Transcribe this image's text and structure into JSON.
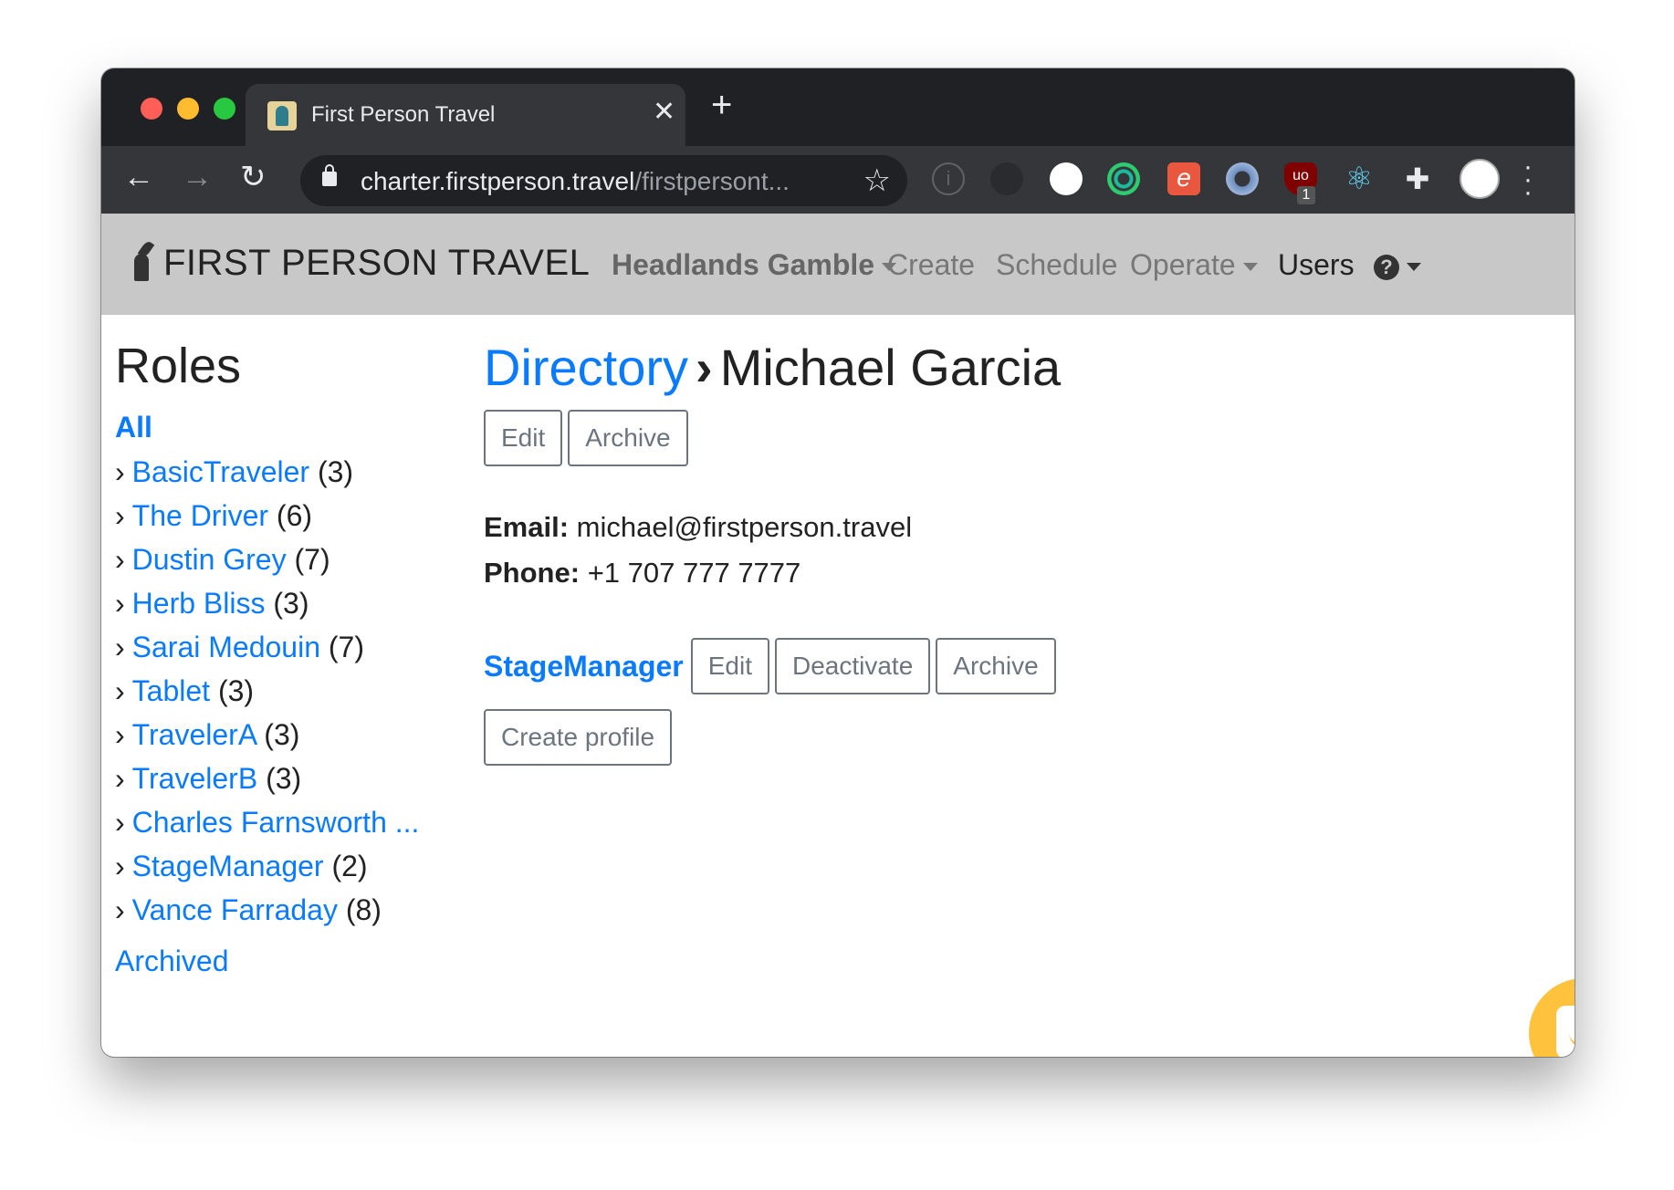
{
  "browser": {
    "tab_title": "First Person Travel",
    "tab_close": "✕",
    "new_tab": "+",
    "url_host": "charter.firstperson.travel",
    "url_rest": "/firstpersont...",
    "extension_badge": "1",
    "extension_ub_label": "uo"
  },
  "navbar": {
    "brand": "FIRST PERSON TRAVEL",
    "experience": "Headlands Gamble",
    "items": {
      "create": "Create",
      "schedule": "Schedule",
      "operate": "Operate",
      "users": "Users"
    },
    "help": "?"
  },
  "sidebar": {
    "title": "Roles",
    "all": "All",
    "roles": [
      {
        "name": "BasicTraveler",
        "count": "(3)"
      },
      {
        "name": "The Driver",
        "count": "(6)"
      },
      {
        "name": "Dustin Grey",
        "count": "(7)"
      },
      {
        "name": "Herb Bliss",
        "count": "(3)"
      },
      {
        "name": "Sarai Medouin",
        "count": "(7)"
      },
      {
        "name": "Tablet",
        "count": "(3)"
      },
      {
        "name": "TravelerA",
        "count": "(3)"
      },
      {
        "name": "TravelerB",
        "count": "(3)"
      },
      {
        "name": "Charles Farnsworth ...",
        "count": ""
      },
      {
        "name": "StageManager",
        "count": "(2)"
      },
      {
        "name": "Vance Farraday",
        "count": "(8)"
      }
    ],
    "archived": "Archived",
    "bullet": "›"
  },
  "main": {
    "breadcrumb_link": "Directory",
    "breadcrumb_sep": "›",
    "breadcrumb_current": "Michael Garcia",
    "edit_label": "Edit",
    "archive_label": "Archive",
    "email_label": "Email:",
    "email_value": "michael@firstperson.travel",
    "phone_label": "Phone:",
    "phone_value": "+1 707 777 7777",
    "profile": {
      "role": "StageManager",
      "edit_label": "Edit",
      "deactivate_label": "Deactivate",
      "archive_label": "Archive"
    },
    "create_profile_label": "Create profile"
  },
  "colors": {
    "link": "#0a7bff",
    "navbar_bg": "#c8c8c8",
    "chat_launcher": "#ffc23d"
  }
}
